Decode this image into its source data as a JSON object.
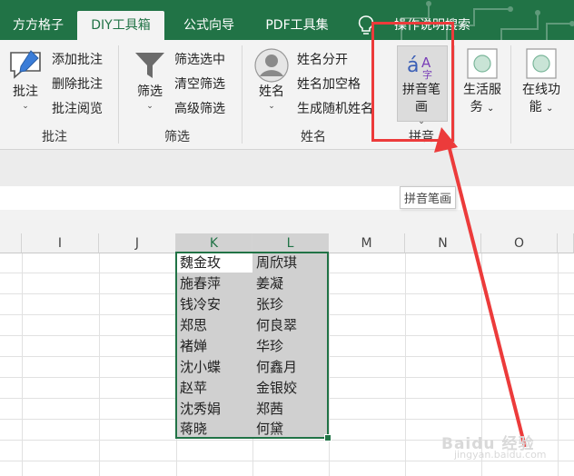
{
  "tabs": [
    {
      "label": "方方格子",
      "active": false
    },
    {
      "label": "DIY工具箱",
      "active": true
    },
    {
      "label": "公式向导",
      "active": false
    },
    {
      "label": "PDF工具集",
      "active": false
    }
  ],
  "tell_me": "操作说明搜索",
  "groups": {
    "comment": {
      "big": "批注",
      "items": [
        "添加批注",
        "删除批注",
        "批注阅览"
      ],
      "label": "批注"
    },
    "filter": {
      "big": "筛选",
      "items": [
        "筛选选中",
        "清空筛选",
        "高级筛选"
      ],
      "label": "筛选"
    },
    "name": {
      "big": "姓名",
      "items": [
        "姓名分开",
        "姓名加空格",
        "生成随机姓名"
      ],
      "label": "姓名"
    },
    "pinyin": {
      "big_line1": "拼音笔",
      "big_line2": "画",
      "label": "拼音"
    },
    "life": {
      "line1": "生活服",
      "line2": "务"
    },
    "online": {
      "line1": "在线功",
      "line2": "能"
    }
  },
  "tooltip": "拼音笔画",
  "columns": [
    "I",
    "J",
    "K",
    "L",
    "M",
    "N",
    "O"
  ],
  "cells": {
    "K": [
      "魏金玫",
      "施春萍",
      "钱冷安",
      "郑思",
      "褚婵",
      "沈小蝶",
      "赵苹",
      "沈秀娟",
      "蒋晓"
    ],
    "L": [
      "周欣琪",
      "姜凝",
      "张珍",
      "何良翠",
      "华珍",
      "何鑫月",
      "金银姣",
      "郑茜",
      "何黛"
    ]
  },
  "watermark": {
    "main": "Baidu 经验",
    "sub": "jingyan.baidu.com"
  },
  "colors": {
    "accent": "#217346",
    "highlight": "#ec3b3b"
  }
}
